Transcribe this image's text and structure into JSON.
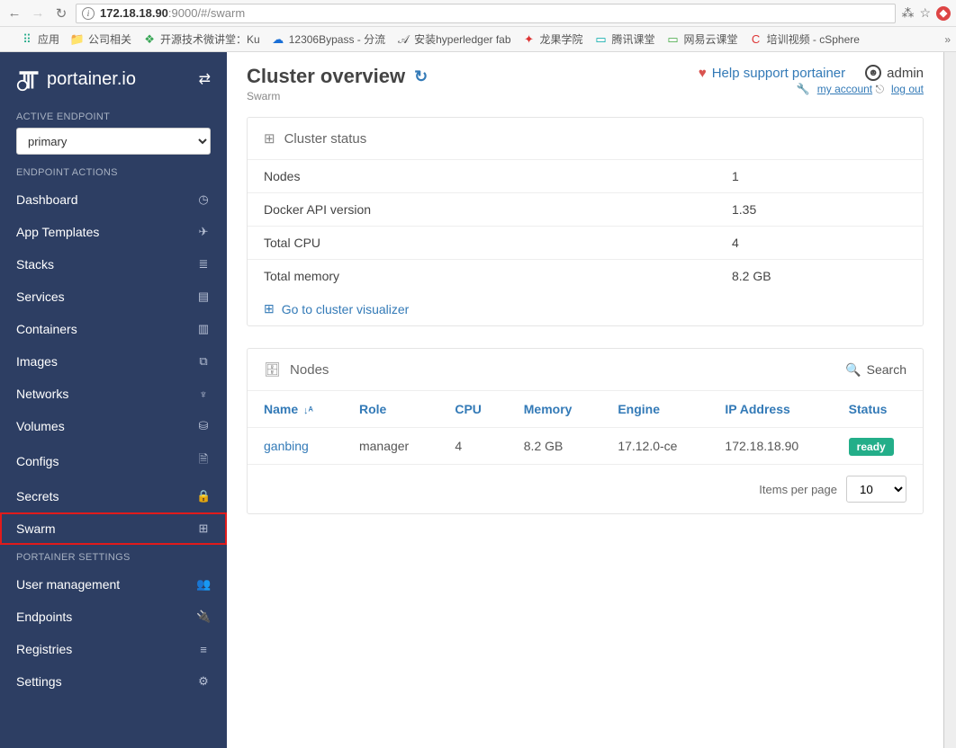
{
  "browser": {
    "url_host": "172.18.18.90",
    "url_path": ":9000/#/swarm",
    "bookmarks": [
      {
        "icon": "⠿",
        "color": "#2a8",
        "label": "应用"
      },
      {
        "icon": "📁",
        "color": "#e8a43a",
        "label": "公司相关"
      },
      {
        "icon": "❖",
        "color": "#3aa757",
        "label": "开源技术微讲堂：Ku"
      },
      {
        "icon": "☁",
        "color": "#1a6fd6",
        "label": "12306Bypass - 分流"
      },
      {
        "icon": "𝒜",
        "color": "#555",
        "label": "安装hyperledger fab"
      },
      {
        "icon": "✦",
        "color": "#d33",
        "label": "龙果学院"
      },
      {
        "icon": "▭",
        "color": "#0aa",
        "label": "腾讯课堂"
      },
      {
        "icon": "▭",
        "color": "#4a4",
        "label": "网易云课堂"
      },
      {
        "icon": "C",
        "color": "#d33",
        "label": "培训视频 - cSphere"
      }
    ]
  },
  "brand": "portainer.io",
  "sidebar": {
    "active_endpoint_label": "ACTIVE ENDPOINT",
    "endpoint_value": "primary",
    "endpoint_actions_label": "ENDPOINT ACTIONS",
    "items": [
      {
        "label": "Dashboard",
        "icon": "◷"
      },
      {
        "label": "App Templates",
        "icon": "✈"
      },
      {
        "label": "Stacks",
        "icon": "≣"
      },
      {
        "label": "Services",
        "icon": "▤"
      },
      {
        "label": "Containers",
        "icon": "▥"
      },
      {
        "label": "Images",
        "icon": "⧉"
      },
      {
        "label": "Networks",
        "icon": "♆"
      },
      {
        "label": "Volumes",
        "icon": "⛁"
      },
      {
        "label": "Configs",
        "icon": "🗎"
      },
      {
        "label": "Secrets",
        "icon": "🔒"
      },
      {
        "label": "Swarm",
        "icon": "⊞",
        "active": true
      }
    ],
    "settings_label": "PORTAINER SETTINGS",
    "settings_items": [
      {
        "label": "User management",
        "icon": "👥"
      },
      {
        "label": "Endpoints",
        "icon": "🔌"
      },
      {
        "label": "Registries",
        "icon": "≡"
      },
      {
        "label": "Settings",
        "icon": "⚙"
      }
    ]
  },
  "header": {
    "title": "Cluster overview",
    "breadcrumb": "Swarm",
    "support_label": "Help support portainer",
    "username": "admin",
    "my_account": "my account",
    "logout": "log out"
  },
  "cluster_panel": {
    "title": "Cluster status",
    "rows": [
      {
        "k": "Nodes",
        "v": "1"
      },
      {
        "k": "Docker API version",
        "v": "1.35"
      },
      {
        "k": "Total CPU",
        "v": "4"
      },
      {
        "k": "Total memory",
        "v": "8.2 GB"
      }
    ],
    "visualizer_label": "Go to cluster visualizer"
  },
  "nodes_panel": {
    "title": "Nodes",
    "search_label": "Search",
    "columns": [
      "Name",
      "Role",
      "CPU",
      "Memory",
      "Engine",
      "IP Address",
      "Status"
    ],
    "rows": [
      {
        "name": "ganbing",
        "role": "manager",
        "cpu": "4",
        "memory": "8.2 GB",
        "engine": "17.12.0-ce",
        "ip": "172.18.18.90",
        "status": "ready"
      }
    ],
    "pager_label": "Items per page",
    "pager_value": "10"
  }
}
